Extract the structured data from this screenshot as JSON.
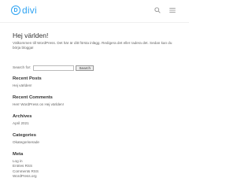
{
  "site": {
    "logo_mark": "D",
    "logo_text": "divi"
  },
  "header": {
    "search_icon": "search-icon",
    "menu_icon": "hamburger-menu-icon"
  },
  "post": {
    "title": "Hej världen!",
    "body": "Välkommen till WordPress. Det här är ditt första inlägg. Redigera det eller radera det. Sedan kan du börja blogga!"
  },
  "search": {
    "label": "Search for:",
    "value": "",
    "button": "Search"
  },
  "widgets": {
    "recent_posts": {
      "title": "Recent Posts",
      "items": [
        "Hej världen!"
      ]
    },
    "recent_comments": {
      "title": "Recent Comments",
      "items": [
        "Herr WordPress on Hej världen!"
      ]
    },
    "archives": {
      "title": "Archives",
      "items": [
        "April 2021"
      ]
    },
    "categories": {
      "title": "Categories",
      "items": [
        "Okategoriserade"
      ]
    },
    "meta": {
      "title": "Meta",
      "items": [
        "Log in",
        "Entries RSS",
        "Comments RSS",
        "WordPress.org"
      ]
    }
  },
  "colors": {
    "accent": "#2ea3f2",
    "heading": "#333333",
    "text": "#666666"
  }
}
